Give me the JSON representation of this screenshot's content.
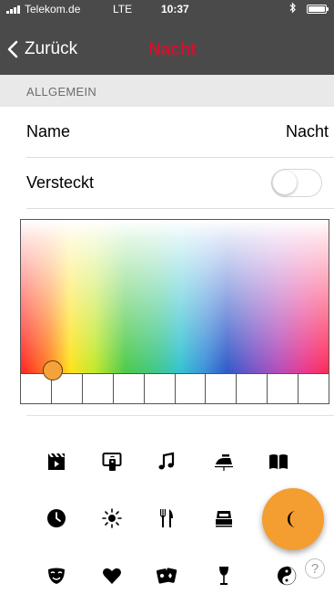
{
  "status_bar": {
    "carrier": "Telekom.de",
    "network": "LTE",
    "time": "10:37",
    "bluetooth_icon": "bluetooth-icon",
    "battery_icon": "battery-icon"
  },
  "nav": {
    "back_label": "Zurück",
    "title": "Nacht",
    "title_color": "#d0122d"
  },
  "section": {
    "header": "ALLGEMEIN"
  },
  "name_row": {
    "label": "Name",
    "value": "Nacht"
  },
  "hidden_row": {
    "label": "Versteckt",
    "toggle_on": false
  },
  "color_palette": {
    "selected_color": "#f5a23a",
    "swatch_count": 10
  },
  "icons": [
    "film-icon",
    "remote-tv-icon",
    "music-note-icon",
    "iron-icon",
    "book-icon",
    "clock-icon",
    "sun-icon",
    "fork-knife-icon",
    "bed-icon",
    "moon-icon",
    "mask-icon",
    "heart-icon",
    "cards-icon",
    "wine-glass-icon",
    "yin-yang-icon"
  ],
  "selected_icon": "moon-icon",
  "accent_color": "#f49d30",
  "help": {
    "label": "?"
  }
}
